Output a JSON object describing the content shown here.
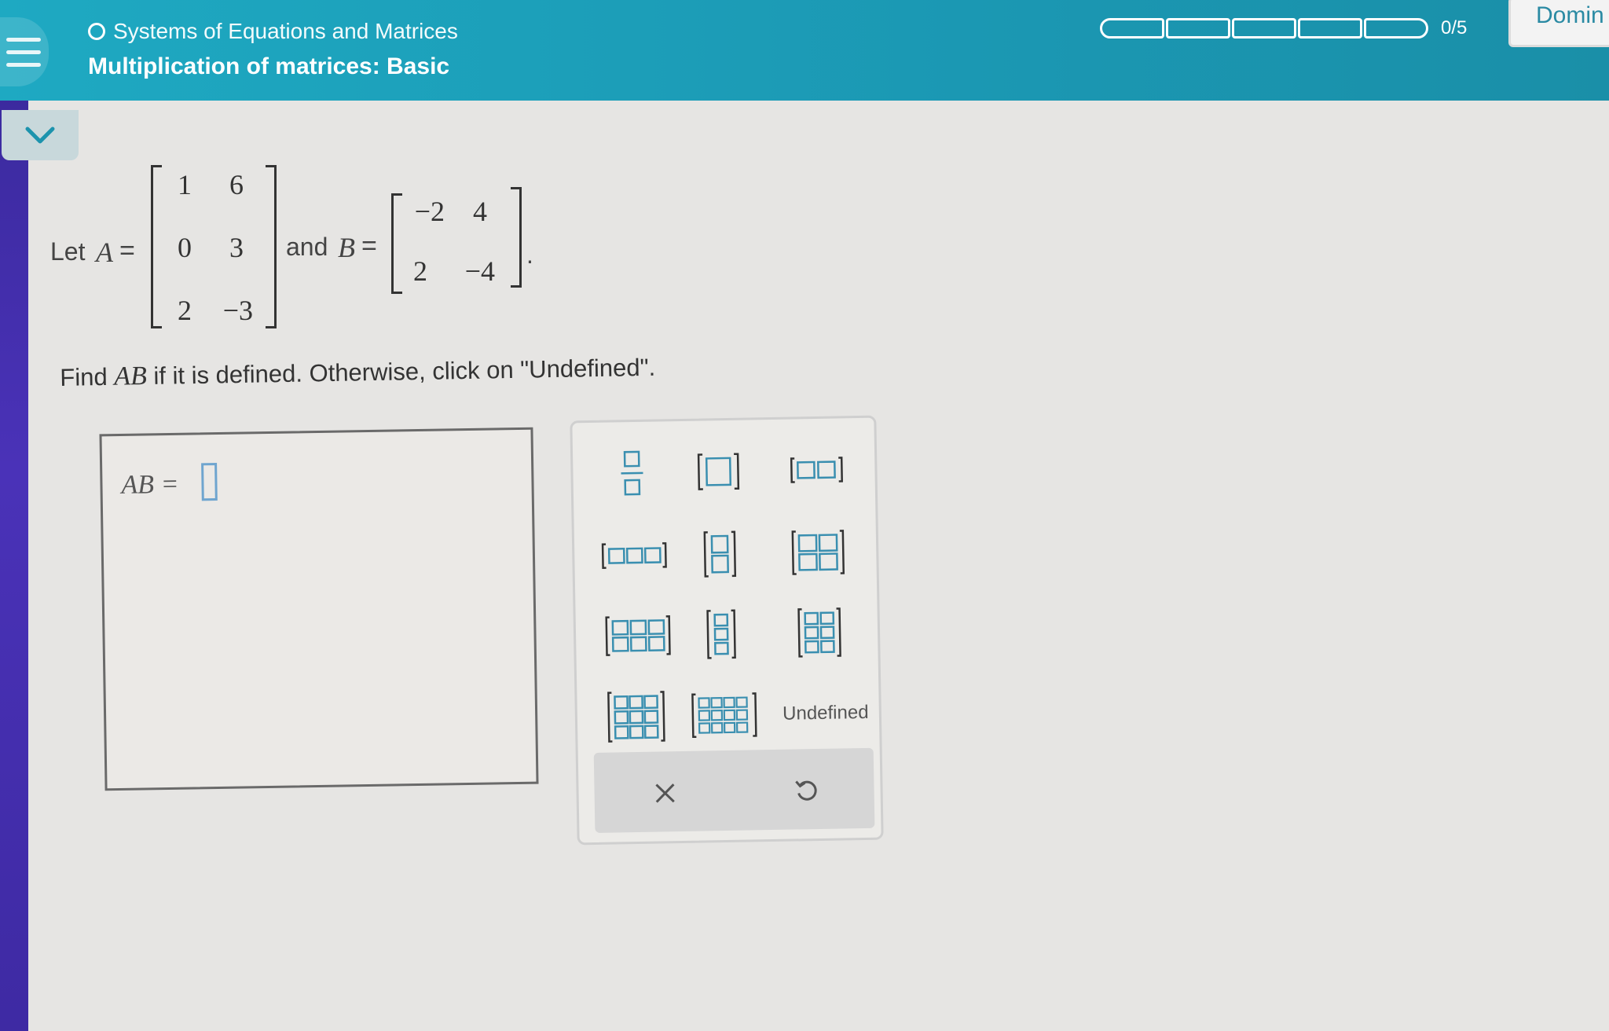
{
  "header": {
    "topic": "Systems of Equations and Matrices",
    "lesson": "Multiplication of matrices: Basic",
    "progress_text": "0/5",
    "progress_segments": 5,
    "progress_completed": 0,
    "right_button_label": "Domin"
  },
  "problem": {
    "let_text": "Let",
    "matrix_a_name": "A",
    "equals": "=",
    "matrix_a": [
      [
        "1",
        "6"
      ],
      [
        "0",
        "3"
      ],
      [
        "2",
        "−3"
      ]
    ],
    "and_text": "and",
    "matrix_b_name": "B",
    "matrix_b": [
      [
        "−2",
        "4"
      ],
      [
        "2",
        "−4"
      ]
    ],
    "period": ".",
    "instruction_prefix": "Find",
    "instruction_math": "AB",
    "instruction_suffix": "if it is defined. Otherwise, click on \"Undefined\"."
  },
  "answer": {
    "label": "AB ="
  },
  "keypad": {
    "keys": [
      "fraction-icon",
      "matrix-1x1-icon",
      "matrix-1x2-icon",
      "matrix-1x3-icon",
      "matrix-2x1-icon",
      "matrix-2x2-icon",
      "matrix-2x3-icon",
      "matrix-3x1-icon",
      "matrix-3x2-icon",
      "matrix-3x3-icon",
      "matrix-3x4-icon"
    ],
    "undefined_label": "Undefined",
    "clear_icon": "close-icon",
    "undo_icon": "undo-icon"
  },
  "colors": {
    "header": "#1ea9c2",
    "accent": "#2a8aa3",
    "left_edge": "#3e2aa3"
  }
}
